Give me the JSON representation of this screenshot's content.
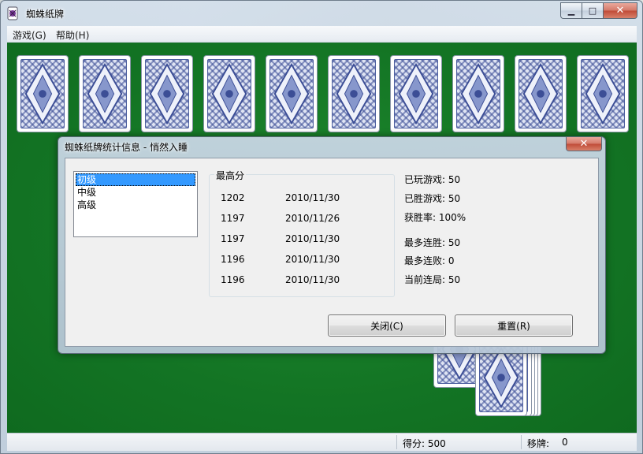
{
  "window": {
    "title": "蜘蛛纸牌"
  },
  "menu": {
    "items": [
      "游戏(G)",
      "帮助(H)"
    ]
  },
  "caption": {
    "minimize": "▁",
    "maximize": "□",
    "close": "✕"
  },
  "dialog": {
    "title": "蜘蛛纸牌统计信息 - 悄然入睡",
    "close": "✕",
    "levels": [
      "初级",
      "中级",
      "高级"
    ],
    "selected_level": "初级",
    "scores_title": "最高分",
    "scores": [
      {
        "points": "1202",
        "date": "2010/11/30"
      },
      {
        "points": "1197",
        "date": "2010/11/26"
      },
      {
        "points": "1197",
        "date": "2010/11/30"
      },
      {
        "points": "1196",
        "date": "2010/11/30"
      },
      {
        "points": "1196",
        "date": "2010/11/30"
      }
    ],
    "stats": {
      "played": "已玩游戏: 50",
      "won": "已胜游戏: 50",
      "win_rate": "获胜率: 100%",
      "most_wins": "最多连胜: 50",
      "most_losses": "最多连败: 0",
      "current_streak": "当前连局: 50"
    },
    "buttons": {
      "close": "关闭(C)",
      "reset": "重置(R)"
    }
  },
  "status": {
    "score": "得分: 500",
    "moves_label": "移牌:",
    "moves_value": "0"
  },
  "colors": {
    "felt": "#137424",
    "selection": "#3399ff",
    "card_back": "#4d5fa0"
  }
}
